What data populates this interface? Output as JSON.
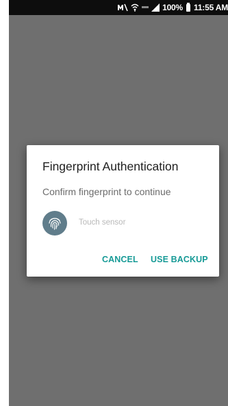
{
  "status_bar": {
    "icons": [
      "mute-icon",
      "wifi-icon",
      "volte-icon",
      "signal-icon",
      "battery-icon"
    ],
    "battery_percent": "100%",
    "time": "11:55 AM"
  },
  "dialog": {
    "title": "Fingerprint Authentication",
    "message": "Confirm fingerprint to continue",
    "sensor_hint": "Touch sensor",
    "icon": "fingerprint-icon",
    "buttons": {
      "cancel": "CANCEL",
      "backup": "USE BACKUP"
    }
  },
  "colors": {
    "accent": "#169a96",
    "fingerprint_bg": "#607d8b",
    "scrim": "#6f6f6f",
    "status_bar": "#0d0d0d"
  }
}
